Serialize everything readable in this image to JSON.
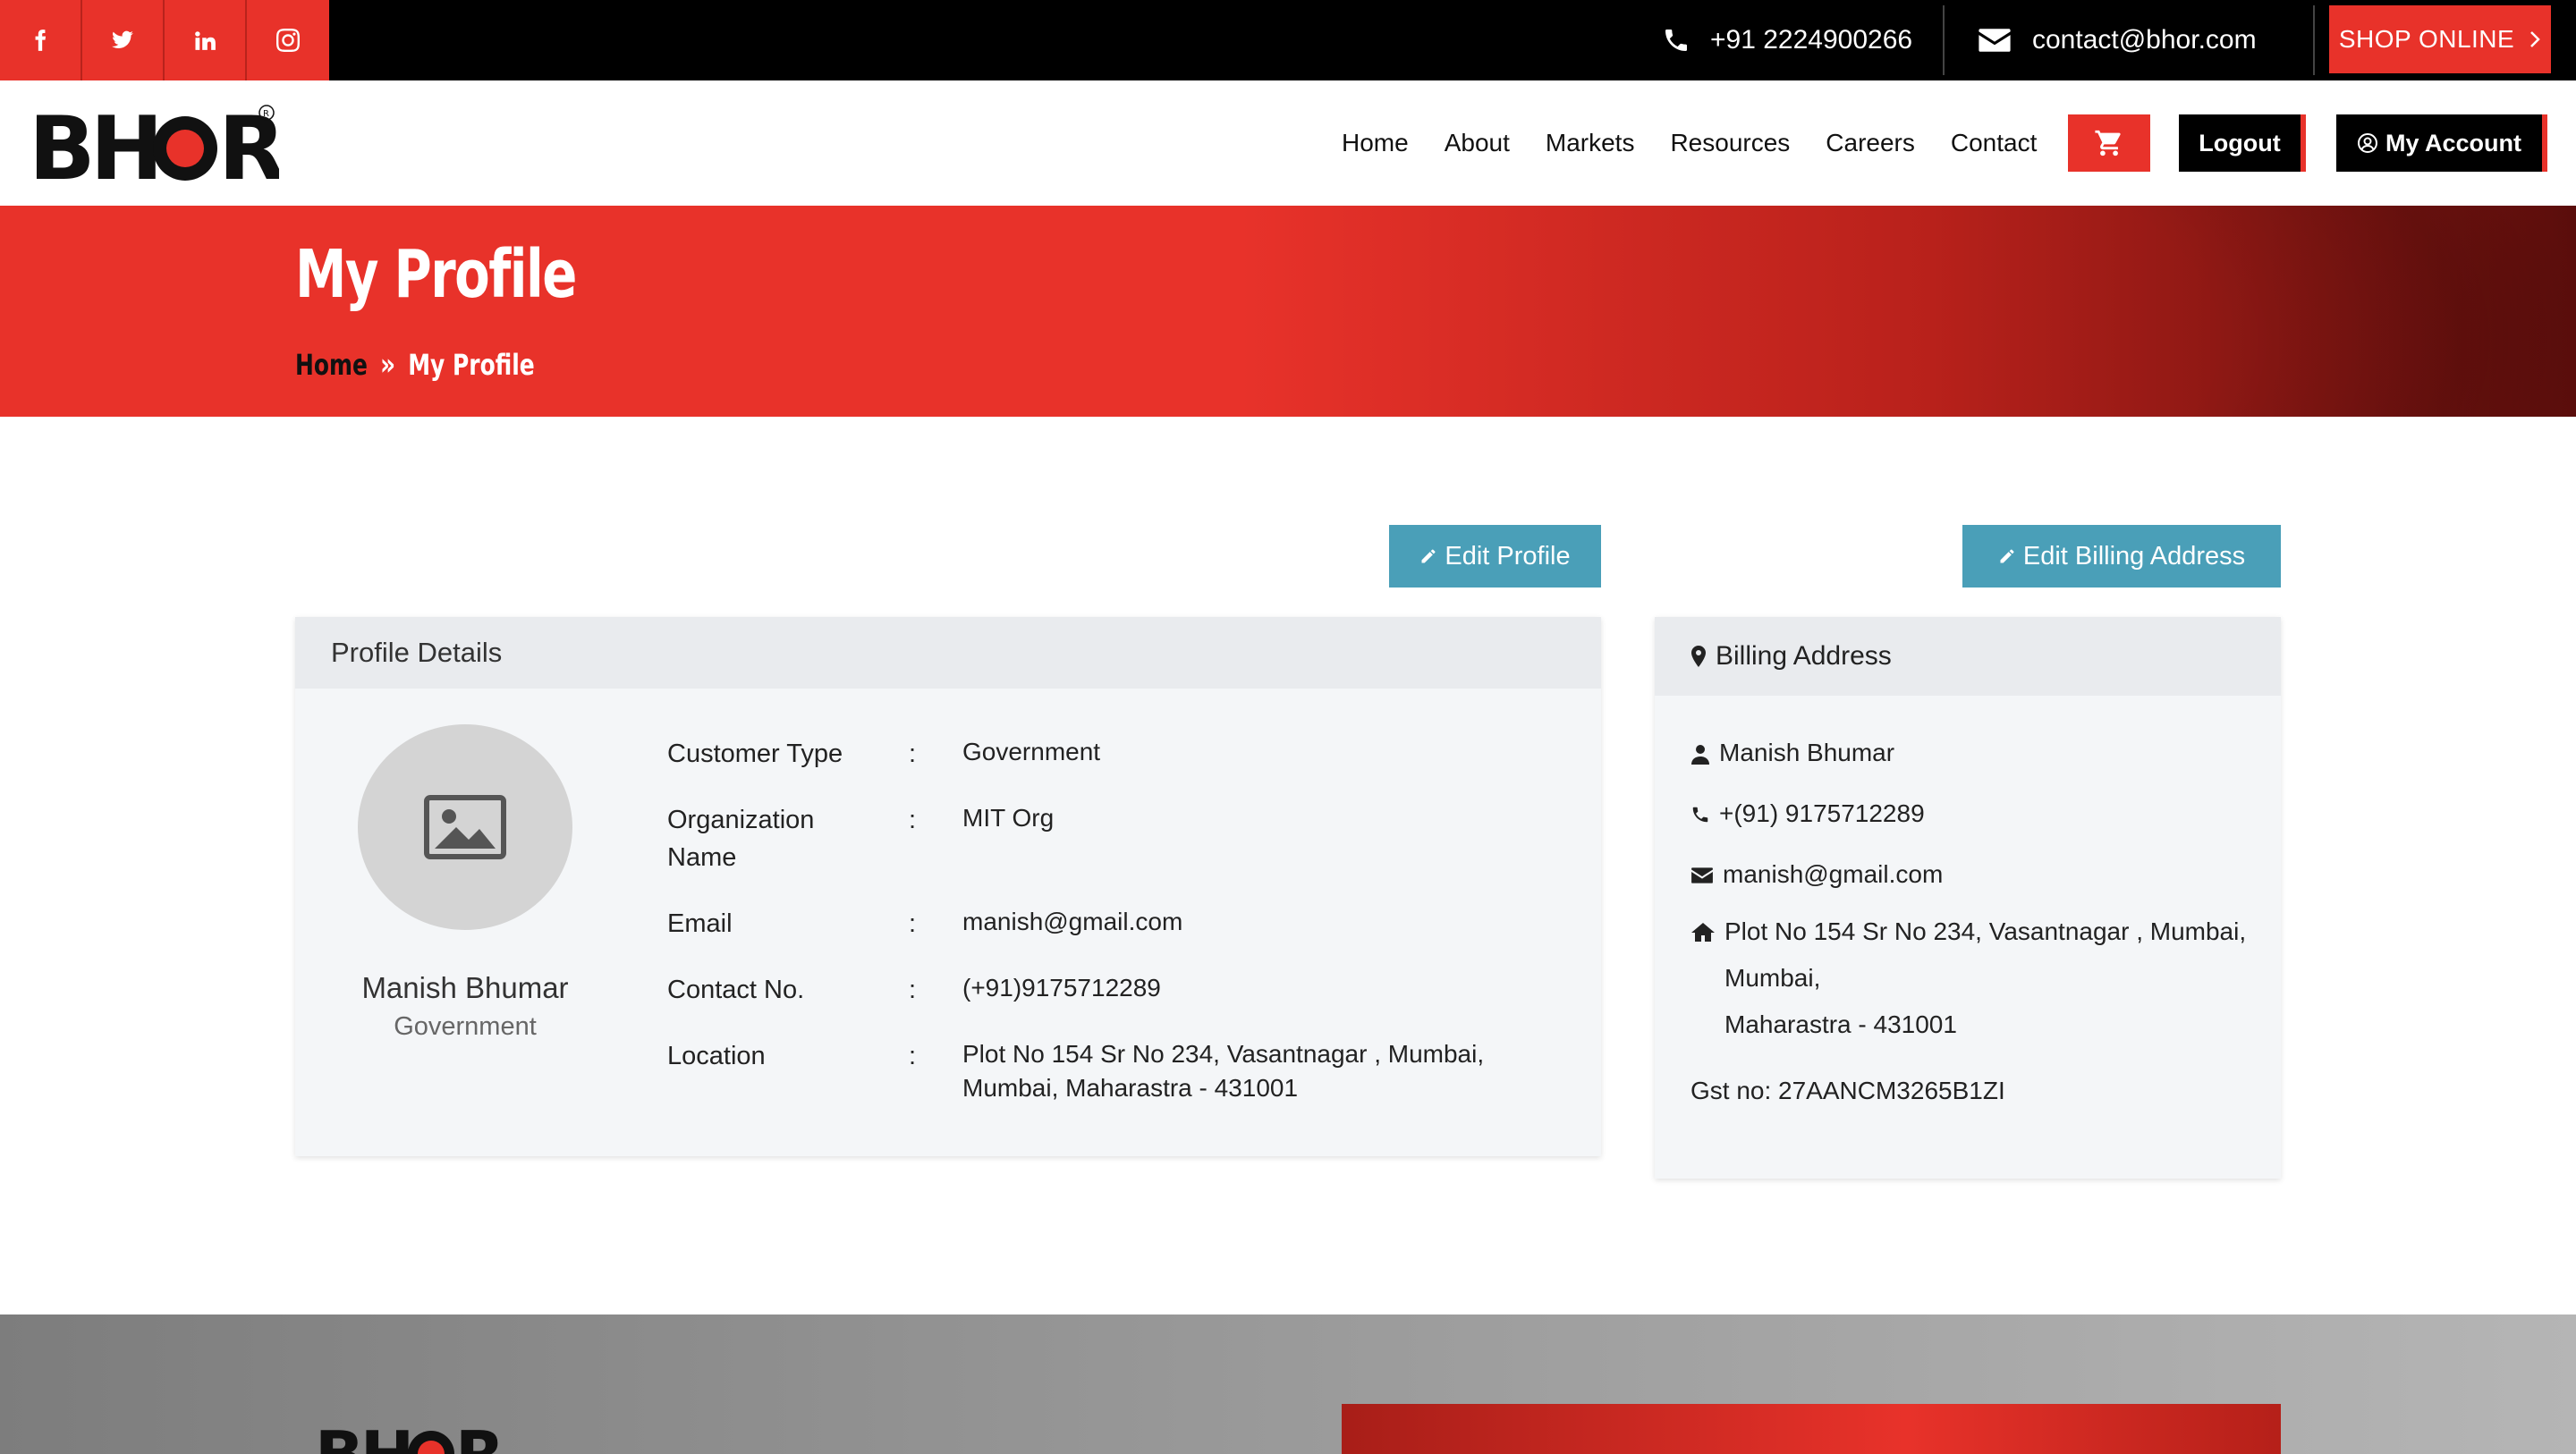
{
  "topbar": {
    "social": [
      {
        "icon": "facebook-icon",
        "label": "f"
      },
      {
        "icon": "twitter-icon",
        "label": "t"
      },
      {
        "icon": "linkedin-icon",
        "label": "in"
      },
      {
        "icon": "instagram-icon",
        "label": "ig"
      }
    ],
    "phone": "+91 2224900266",
    "email": "contact@bhor.com",
    "shop_label": "SHOP ONLINE"
  },
  "nav": {
    "logo_text": "BHOR",
    "links": [
      "Home",
      "About",
      "Markets",
      "Resources",
      "Careers",
      "Contact"
    ],
    "logout_label": "Logout",
    "account_label": "My Account"
  },
  "hero": {
    "title": "My Profile",
    "breadcrumb_home": "Home",
    "breadcrumb_current": "My Profile"
  },
  "actions": {
    "edit_profile": "Edit Profile",
    "edit_billing": "Edit Billing Address"
  },
  "profile": {
    "header": "Profile Details",
    "name": "Manish Bhumar",
    "type": "Government",
    "details": [
      {
        "label": "Customer Type",
        "value": "Government"
      },
      {
        "label": "Organization Name",
        "value": "MIT Org"
      },
      {
        "label": "Email",
        "value": "manish@gmail.com"
      },
      {
        "label": "Contact No.",
        "value": "(+91)9175712289"
      },
      {
        "label": "Location",
        "value": "Plot No 154 Sr No 234, Vasantnagar , Mumbai, Mumbai, Maharastra - 431001"
      }
    ],
    "colon": ":"
  },
  "billing": {
    "header": "Billing Address",
    "name": "Manish Bhumar",
    "phone": "+(91) 9175712289",
    "email": "manish@gmail.com",
    "address_line1": "Plot No 154 Sr No 234, Vasantnagar , Mumbai,",
    "address_line2": "Mumbai,",
    "address_line3": "Maharastra - 431001",
    "gst": "Gst no: 27AANCM3265B1ZI"
  },
  "colors": {
    "brand_red": "#e8322a",
    "teal": "#4a9fb8",
    "black": "#000000"
  }
}
